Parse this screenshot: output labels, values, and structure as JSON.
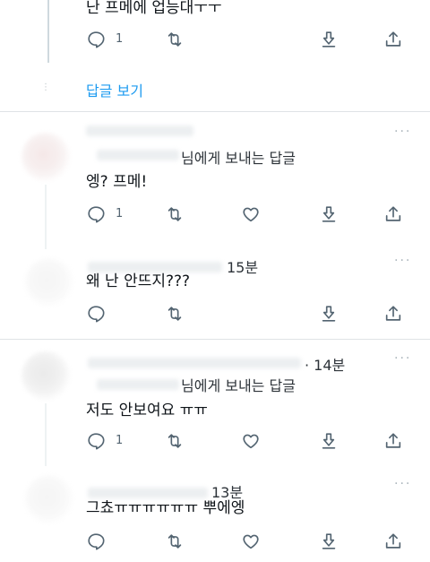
{
  "tweets": [
    {
      "text": "난 프메에 업능대ㅜㅜ",
      "reply_count": "1"
    },
    {
      "show_replies": "답글 보기"
    },
    {
      "reply_to": "님에게 보내는 답글",
      "text": "엥? 프메!",
      "reply_count": "1"
    },
    {
      "time": "15분",
      "text": "왜 난 안뜨지???"
    },
    {
      "time": "· 14분",
      "reply_to": "님에게 보내는 답글",
      "text": "저도 안보여요 ㅠㅠ",
      "reply_count": "1"
    },
    {
      "time": "13분",
      "text": "그쵸ㅠㅠㅠㅠㅠㅠ 뿌에엥"
    }
  ],
  "more_label": "···",
  "icons": [
    "reply-icon",
    "retweet-icon",
    "like-icon",
    "download-icon",
    "share-icon"
  ]
}
